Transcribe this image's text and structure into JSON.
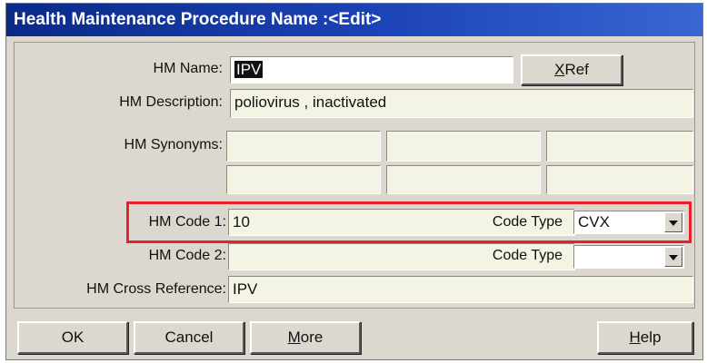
{
  "window": {
    "title": "Health Maintenance Procedure Name :<Edit>"
  },
  "form": {
    "hm_name": {
      "label": "HM Name:",
      "value": "IPV"
    },
    "xref_button": {
      "prefix": "",
      "mnemonic": "X",
      "rest": "Ref"
    },
    "hm_description": {
      "label": "HM Description:",
      "value": "poliovirus , inactivated"
    },
    "hm_synonyms": {
      "label": "HM Synonyms:",
      "values": [
        "",
        "",
        "",
        "",
        "",
        ""
      ]
    },
    "hm_code_1": {
      "label": "HM Code 1:",
      "value": "10",
      "code_type_label": "Code Type",
      "code_type_value": "CVX"
    },
    "hm_code_2": {
      "label": "HM Code 2:",
      "value": "",
      "code_type_label": "Code Type",
      "code_type_value": ""
    },
    "hm_cross_reference": {
      "label": "HM Cross Reference:",
      "value": "IPV"
    }
  },
  "buttons": {
    "ok": "OK",
    "cancel": "Cancel",
    "more": {
      "mnemonic": "M",
      "rest": "ore"
    },
    "help": {
      "mnemonic": "H",
      "rest": "elp"
    }
  },
  "colors": {
    "titlebar": "#1c44b8",
    "field_background": "#f4f4e4",
    "highlight_border": "#e8202a"
  },
  "icons": [
    "chevron-down-icon"
  ]
}
